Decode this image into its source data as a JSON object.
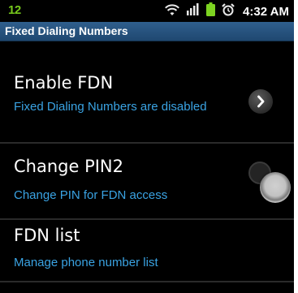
{
  "status_bar": {
    "notification_text": "12",
    "icons": [
      "wifi-icon",
      "signal-icon",
      "battery-icon",
      "alarm-icon"
    ],
    "time": "4:32 AM"
  },
  "title_bar": {
    "title": "Fixed Dialing Numbers"
  },
  "items": [
    {
      "title": "Enable FDN",
      "subtitle": "Fixed Dialing Numbers are disabled",
      "control": "chevron-right-icon"
    },
    {
      "title": "Change PIN2",
      "subtitle": "Change PIN for FDN access",
      "control": "toggle-knob"
    },
    {
      "title": "FDN list",
      "subtitle": "Manage phone number list"
    }
  ],
  "colors": {
    "accent_text": "#3aa3e3",
    "title_bar_background": "#2a5681",
    "notification_green": "#76c81c",
    "battery_green": "#7dd321"
  }
}
